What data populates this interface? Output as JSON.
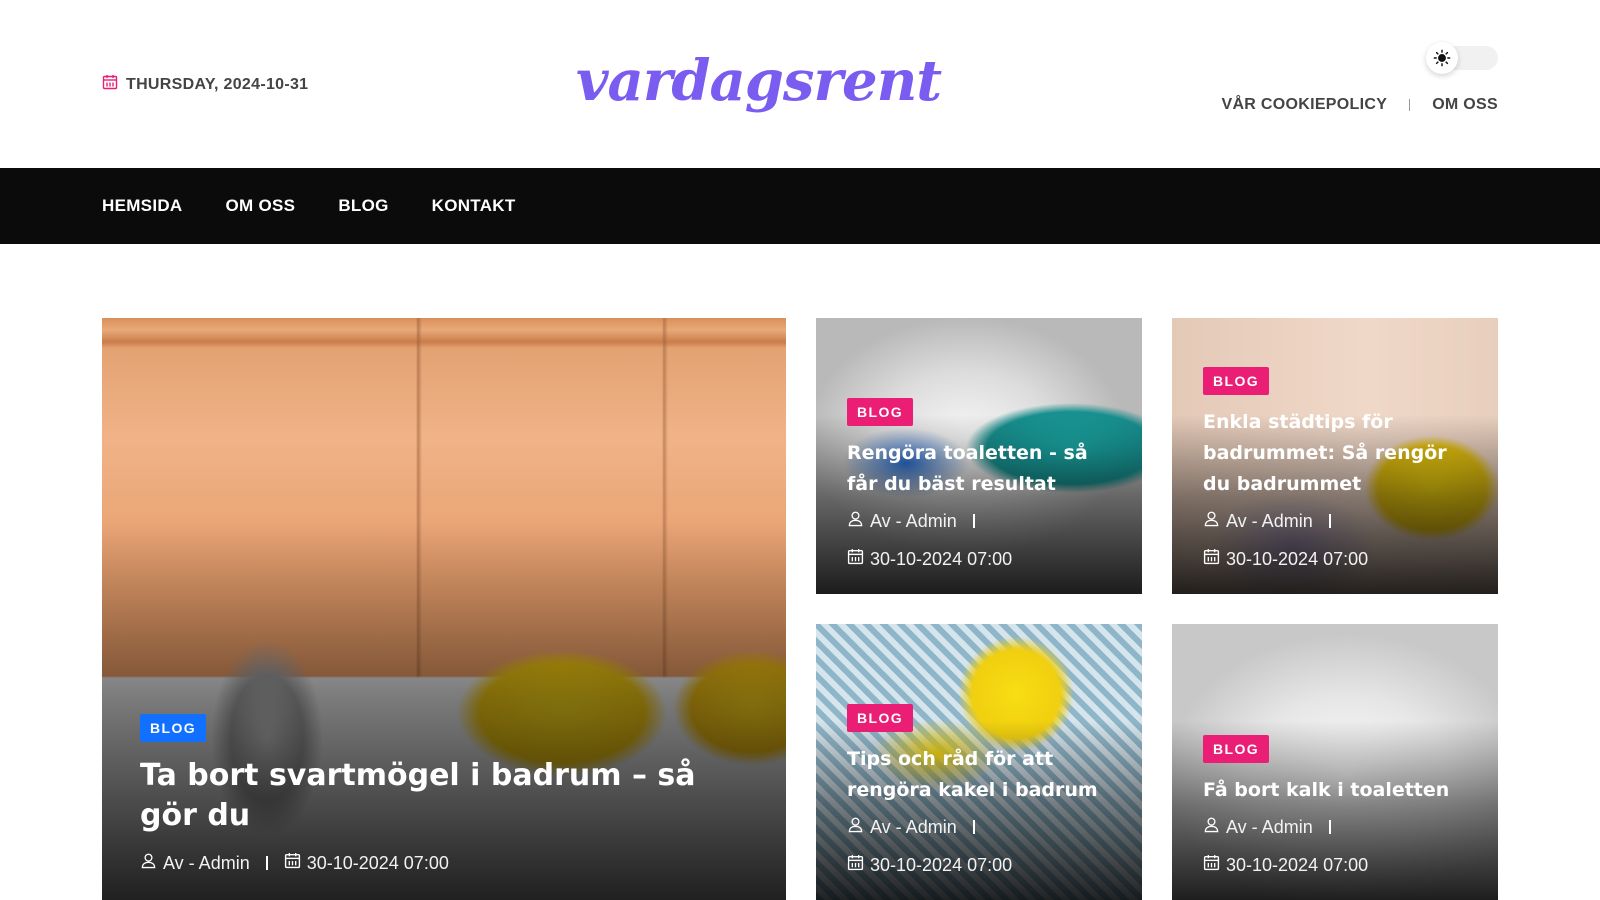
{
  "header": {
    "date": "THURSDAY, 2024-10-31",
    "logo": "vardagsrent",
    "top_links": [
      "VÅR COOKIEPOLICY",
      "OM OSS"
    ]
  },
  "nav": {
    "items": [
      "HEMSIDA",
      "OM OSS",
      "BLOG",
      "KONTAKT"
    ]
  },
  "colors": {
    "accent_logo": "#7b5cf0",
    "badge_blue": "#1170ff",
    "badge_pink": "#e91e74",
    "nav_bg": "#0b0b0b"
  },
  "featured": {
    "category": "BLOG",
    "title": "Ta bort svartmögel i badrum – så gör du",
    "author": "Av - Admin",
    "date": "30-10-2024 07:00"
  },
  "posts": [
    {
      "category": "BLOG",
      "title": "Rengöra toaletten - så får du bäst resultat",
      "author": "Av - Admin",
      "date": "30-10-2024 07:00"
    },
    {
      "category": "BLOG",
      "title": "Enkla städtips för badrummet: Så rengör du badrummet",
      "author": "Av - Admin",
      "date": "30-10-2024 07:00"
    },
    {
      "category": "BLOG",
      "title": "Tips och råd för att rengöra kakel i badrum",
      "author": "Av - Admin",
      "date": "30-10-2024 07:00"
    },
    {
      "category": "BLOG",
      "title": "Få bort kalk i toaletten",
      "author": "Av - Admin",
      "date": "30-10-2024 07:00"
    }
  ],
  "icons": {
    "date": "calendar-icon",
    "theme": "sun-icon",
    "author": "user-icon"
  }
}
